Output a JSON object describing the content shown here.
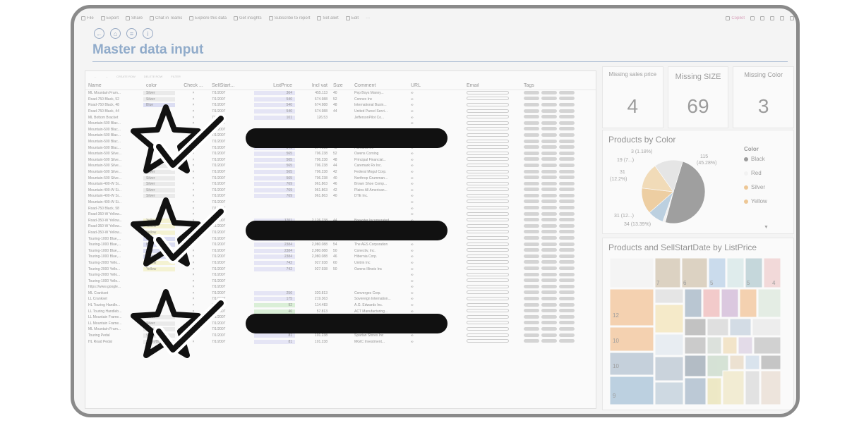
{
  "toolbar": {
    "items": [
      "File",
      "Export",
      "Share",
      "Chat in Teams",
      "Explore this data",
      "Get insights",
      "Subscribe to report",
      "Set alert",
      "Edit",
      "···"
    ],
    "copilot": "Copilot"
  },
  "page_title": "Master data input",
  "grid": {
    "tools": [
      "←",
      "→",
      "CREATE ROW",
      "DELETE ROW",
      "FILTER"
    ],
    "columns": [
      "Name",
      "color",
      "Check ...",
      "SellStart...",
      "ListPrice",
      "Incl vat",
      "Size",
      "Comment",
      "URL",
      "Email",
      "Tags"
    ],
    "rows": [
      {
        "name": "ML Mountain Fram...",
        "color": "Silver",
        "start": "7/1/2007",
        "price": "364",
        "vat": "455.113",
        "size": "40",
        "comment": "Pep Boys Manny..."
      },
      {
        "name": "Road-750 Black, 52",
        "color": "Silver",
        "start": "7/1/2007",
        "price": "540",
        "vat": "674.988",
        "size": "52",
        "comment": "Connex Inc"
      },
      {
        "name": "Road-750 Black, 48",
        "color": "Blue",
        "start": "7/1/2007",
        "price": "540",
        "vat": "674.988",
        "size": "48",
        "comment": "International Busin..."
      },
      {
        "name": "Road-750 Black, 44",
        "color": "",
        "start": "7/1/2007",
        "price": "540",
        "vat": "674.988",
        "size": "44",
        "comment": "United Parcel Servi..."
      },
      {
        "name": "ML Bottom Bracket",
        "color": "",
        "start": "7/1/2007",
        "price": "101",
        "vat": "126.53",
        "size": "",
        "comment": "JeffersonPilot Co..."
      },
      {
        "name": "Mountain-500 Blac...",
        "color": "",
        "start": "7/1/2007",
        "price": "",
        "vat": "",
        "size": "",
        "comment": ""
      },
      {
        "name": "Mountain-500 Blac...",
        "color": "",
        "start": "7/1/2007",
        "price": "",
        "vat": "",
        "size": "",
        "comment": ""
      },
      {
        "name": "Mountain-500 Blac...",
        "color": "",
        "start": "7/1/2007",
        "price": "",
        "vat": "",
        "size": "",
        "comment": ""
      },
      {
        "name": "Mountain-500 Blac...",
        "color": "",
        "start": "7/1/2007",
        "price": "540",
        "vat": "674.988",
        "size": "42",
        "comment": "Belk, Inc."
      },
      {
        "name": "Mountain-500 Blac...",
        "color": "",
        "start": "7/1/2007",
        "price": "540",
        "vat": "674.988",
        "size": "40",
        "comment": "Humana Inc"
      },
      {
        "name": "Mountain-500 Silve...",
        "color": "",
        "start": "7/1/2007",
        "price": "565",
        "vat": "706.238",
        "size": "52",
        "comment": "Owens Corning"
      },
      {
        "name": "Mountain-500 Silve...",
        "color": "",
        "start": "7/1/2007",
        "price": "565",
        "vat": "706.238",
        "size": "48",
        "comment": "Principal Financial..."
      },
      {
        "name": "Mountain-500 Silve...",
        "color": "Silver",
        "start": "7/1/2007",
        "price": "565",
        "vat": "706.238",
        "size": "44",
        "comment": "Caremark Rx Inc."
      },
      {
        "name": "Mountain-500 Silve...",
        "color": "Silver",
        "start": "7/1/2007",
        "price": "565",
        "vat": "706.238",
        "size": "42",
        "comment": "Federal Mogul Corp."
      },
      {
        "name": "Mountain-500 Silve...",
        "color": "Silver",
        "start": "7/1/2007",
        "price": "565",
        "vat": "706.238",
        "size": "40",
        "comment": "Northrop Grumman..."
      },
      {
        "name": "Mountain-400-W Si...",
        "color": "Silver",
        "start": "7/1/2007",
        "price": "769",
        "vat": "961.863",
        "size": "46",
        "comment": "Brown Shoe Comp..."
      },
      {
        "name": "Mountain-400-W Si...",
        "color": "Silver",
        "start": "7/1/2007",
        "price": "769",
        "vat": "961.863",
        "size": "42",
        "comment": "Plains All American..."
      },
      {
        "name": "Mountain-400-W Si...",
        "color": "Silver",
        "start": "7/1/2007",
        "price": "769",
        "vat": "961.863",
        "size": "40",
        "comment": "DTE Inc."
      },
      {
        "name": "Mountain-400-W Si...",
        "color": "",
        "start": "7/1/2007",
        "price": "",
        "vat": "",
        "size": "",
        "comment": ""
      },
      {
        "name": "Road-750 Black, 58",
        "color": "",
        "start": "7/1/2007",
        "price": "",
        "vat": "",
        "size": "",
        "comment": ""
      },
      {
        "name": "Road-350-W Yellow...",
        "color": "",
        "start": "7/1/2007",
        "price": "",
        "vat": "",
        "size": "",
        "comment": ""
      },
      {
        "name": "Road-350-W Yellow...",
        "color": "Yellow",
        "start": "7/1/2007",
        "price": "1701",
        "vat": "2,126.238",
        "size": "44",
        "comment": "Brewster Incorporated"
      },
      {
        "name": "Road-350-W Yellow...",
        "color": "Yellow",
        "start": "7/1/2007",
        "price": "1701",
        "vat": "2,126.238",
        "size": "42",
        "comment": "Weis Markets Inc."
      },
      {
        "name": "Road-350-W Yellow...",
        "color": "Yellow",
        "start": "7/1/2007",
        "price": "1701",
        "vat": "2,126.238",
        "size": "40",
        "comment": "Fluor Corp"
      },
      {
        "name": "Touring-1000 Blue,...",
        "color": "Blue",
        "start": "7/1/2007",
        "price": "2384",
        "vat": "2,980.088",
        "size": "60",
        "comment": "Astoria Financial C..."
      },
      {
        "name": "Touring-1000 Blue,...",
        "color": "Blue",
        "start": "7/1/2007",
        "price": "2384",
        "vat": "2,980.088",
        "size": "54",
        "comment": "The AES Corporation"
      },
      {
        "name": "Touring-1000 Blue,...",
        "color": "Blue",
        "start": "7/1/2007",
        "price": "2384",
        "vat": "2,980.088",
        "size": "50",
        "comment": "Conectiv, Inc."
      },
      {
        "name": "Touring-1000 Blue,...",
        "color": "Blue",
        "start": "7/1/2007",
        "price": "2384",
        "vat": "2,980.088",
        "size": "46",
        "comment": "Hibernia Corp."
      },
      {
        "name": "Touring-2000 Yello...",
        "color": "Yellow",
        "start": "7/1/2007",
        "price": "742",
        "vat": "927.938",
        "size": "60",
        "comment": "Unitrin Inc"
      },
      {
        "name": "Touring-2000 Yello...",
        "color": "Yellow",
        "start": "7/1/2007",
        "price": "742",
        "vat": "927.938",
        "size": "50",
        "comment": "Owens-Illinois Inc"
      },
      {
        "name": "Touring-2000 Yello...",
        "color": "",
        "start": "7/1/2007",
        "price": "",
        "vat": "",
        "size": "",
        "comment": ""
      },
      {
        "name": "Touring-1000 Yello...",
        "color": "",
        "start": "7/1/2007",
        "price": "",
        "vat": "",
        "size": "",
        "comment": ""
      },
      {
        "name": "https://www.google...",
        "color": "",
        "start": "7/1/2007",
        "price": "",
        "vat": "",
        "size": "",
        "comment": ""
      },
      {
        "name": "ML Crankset",
        "color": "",
        "start": "7/1/2007",
        "price": "256",
        "vat": "320.813",
        "size": "",
        "comment": "Converges Corp."
      },
      {
        "name": "LL Crankset",
        "color": "",
        "start": "7/1/2007",
        "price": "175",
        "vat": "219.363",
        "size": "",
        "comment": "Sovereign Internation..."
      },
      {
        "name": "HL Touring Handle...",
        "color": "",
        "start": "7/1/2007",
        "price": "92",
        "vat": "114.483",
        "size": "",
        "comment": "A.G. Edwards Inc."
      },
      {
        "name": "LL Touring Handleb...",
        "color": "",
        "start": "7/1/2007",
        "price": "46",
        "vat": "57.813",
        "size": "",
        "comment": "ACT Manufacturing..."
      },
      {
        "name": "LL Mountain Frame...",
        "color": "Silver",
        "start": "7/1/2007",
        "price": "264",
        "vat": "330.063",
        "size": "40",
        "comment": "Tech Data Corporat..."
      },
      {
        "name": "LL Mountain Frame...",
        "color": "Silver",
        "start": "7/1/2007",
        "price": "250",
        "vat": "312.238",
        "size": "40",
        "comment": "Amazon.com, Inc."
      },
      {
        "name": "ML Mountain Fram...",
        "color": "Silver",
        "start": "7/1/2007",
        "price": "364",
        "vat": "455.113",
        "size": "38",
        "comment": "Circuit City Stores I..."
      },
      {
        "name": "Touring Pedal",
        "color": "Silver/Black",
        "start": "7/1/2007",
        "price": "81",
        "vat": "101.238",
        "size": "",
        "comment": "Spartan Stores Inc"
      },
      {
        "name": "HL Road Pedal",
        "color": "Silver/Black",
        "start": "7/1/2007",
        "price": "81",
        "vat": "101.238",
        "size": "",
        "comment": "MGIC Investment..."
      }
    ]
  },
  "kpis": [
    {
      "label": "Missing sales price",
      "value": "4"
    },
    {
      "label": "Missing SIZE",
      "value": "69"
    },
    {
      "label": "Missing Color",
      "value": "3"
    }
  ],
  "pie": {
    "title": "Products by Color",
    "legend_title": "Color",
    "legend": [
      {
        "name": "Black",
        "color": "#555555"
      },
      {
        "name": "Red",
        "color": "#f2f2f2"
      },
      {
        "name": "Silver",
        "color": "#e8a44a"
      },
      {
        "name": "Yellow",
        "color": "#e8a44a"
      }
    ],
    "labels": [
      "115",
      "(45.28%)",
      "3 (1.18%)",
      "19 (7...)",
      "31",
      "(12.2%)",
      "31 (12...)",
      "34 (13.39%)"
    ]
  },
  "treemap": {
    "title": "Products and SellStartDate by ListPrice",
    "numbers": [
      "12",
      "10",
      "10",
      "9",
      "7",
      "6",
      "5",
      "5",
      "4"
    ]
  },
  "chart_data": {
    "type": "pie",
    "title": "Products by Color",
    "slices": [
      {
        "label": "115 (45.28%)",
        "value": 115
      },
      {
        "label": "3 (1.18%)",
        "value": 3
      },
      {
        "label": "19 (7...)",
        "value": 19
      },
      {
        "label": "31 (12.2%)",
        "value": 31
      },
      {
        "label": "31 (12...)",
        "value": 31
      },
      {
        "label": "34 (13.39%)",
        "value": 34
      }
    ]
  },
  "colors": {
    "accent": "#3f6fa8",
    "overlay_icon": "#111111"
  }
}
